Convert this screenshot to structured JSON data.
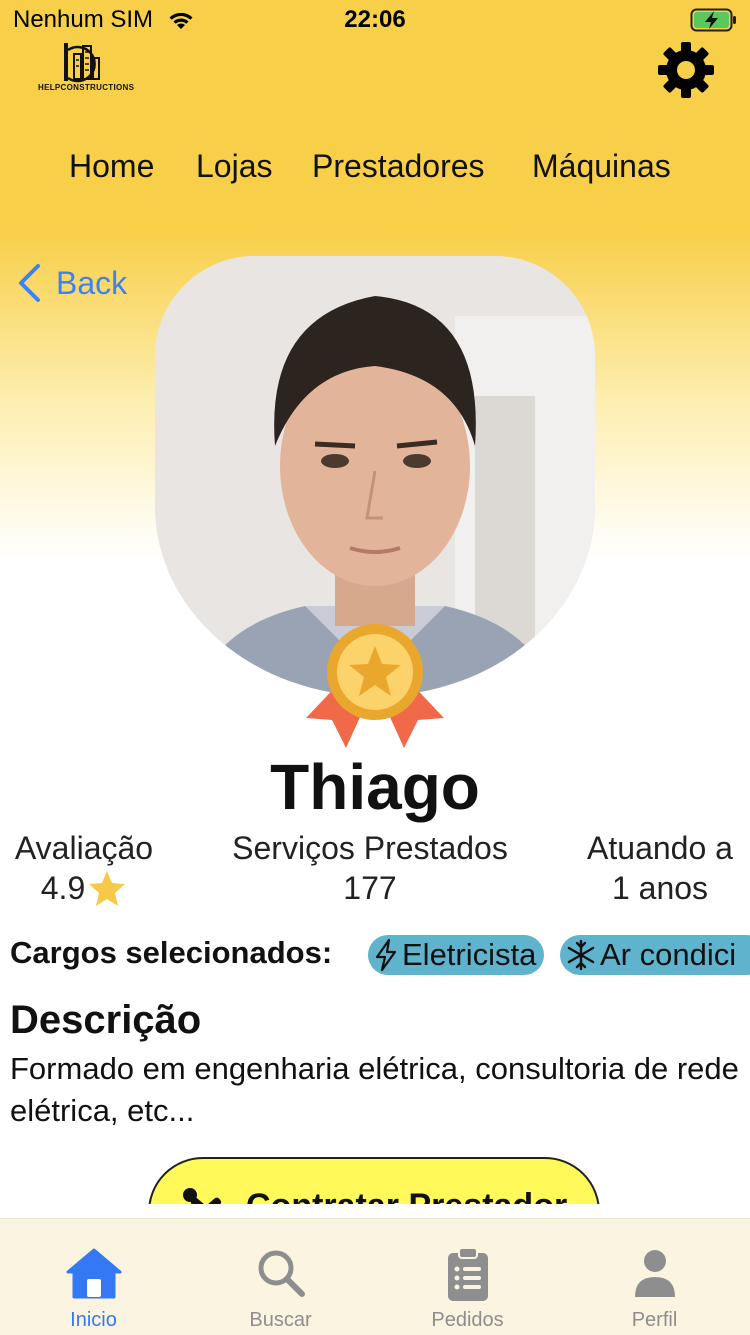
{
  "status_bar": {
    "carrier": "Nenhum SIM",
    "time": "22:06"
  },
  "header": {
    "logo_text": "HELPCONSTRUCTIONS",
    "settings_icon": "gear-icon"
  },
  "nav": {
    "items": [
      {
        "label": "Home"
      },
      {
        "label": "Lojas"
      },
      {
        "label": "Prestadores"
      },
      {
        "label": "Máquinas"
      }
    ]
  },
  "back": {
    "label": "Back"
  },
  "profile": {
    "name": "Thiago",
    "stats": [
      {
        "label": "Avaliação",
        "value": "4.9"
      },
      {
        "label": "Serviços Prestados",
        "value": "177"
      },
      {
        "label": "Atuando a",
        "value": "1 anos"
      }
    ],
    "roles_label": "Cargos selecionados:",
    "roles": [
      {
        "label": "Eletricista",
        "icon": "lightning-icon"
      },
      {
        "label": "Ar condici",
        "icon": "snowflake-icon"
      }
    ],
    "description_title": "Descrição",
    "description": "Formado em engenharia elétrica, consultoria de rede elétrica, etc..."
  },
  "cta": {
    "label": "Contratar Prestador"
  },
  "tabbar": {
    "items": [
      {
        "label": "Inicio",
        "icon": "home-icon",
        "active": true
      },
      {
        "label": "Buscar",
        "icon": "search-icon",
        "active": false
      },
      {
        "label": "Pedidos",
        "icon": "clipboard-icon",
        "active": false
      },
      {
        "label": "Perfil",
        "icon": "user-icon",
        "active": false
      }
    ]
  },
  "colors": {
    "header_yellow": "#f8cf48",
    "accent_blue": "#3478f6",
    "chip": "#5fb3cc",
    "cta": "#fff95a",
    "star": "#f7c948"
  }
}
